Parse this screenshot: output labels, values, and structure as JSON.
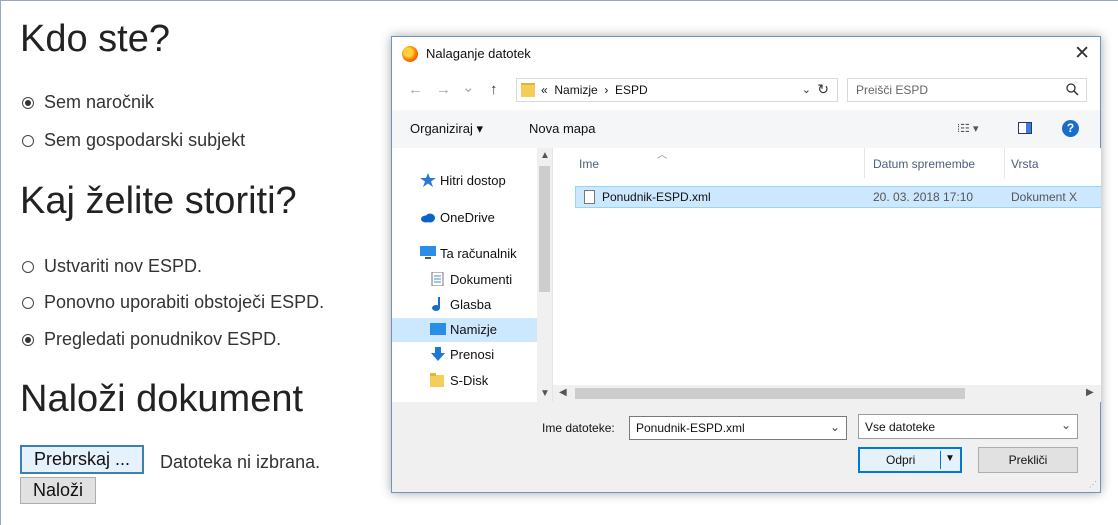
{
  "form": {
    "who_title": "Kdo ste?",
    "role_options": [
      {
        "label": "Sem naročnik",
        "checked": true
      },
      {
        "label": "Sem gospodarski subjekt",
        "checked": false
      }
    ],
    "action_title": "Kaj želite storiti?",
    "action_options": [
      {
        "label": "Ustvariti nov ESPD.",
        "checked": false
      },
      {
        "label": "Ponovno uporabiti obstoječi ESPD.",
        "checked": false
      },
      {
        "label": "Pregledati ponudnikov ESPD.",
        "checked": true
      }
    ],
    "upload_title": "Naloži dokument",
    "browse_label": "Prebrskaj ...",
    "file_status": "Datoteka ni izbrana.",
    "upload_button": "Naloži"
  },
  "dialog": {
    "title": "Nalaganje datotek",
    "close_glyph": "✕",
    "nav": {
      "back": "←",
      "forward": "→",
      "recent": "⌄",
      "up": "↑"
    },
    "address": {
      "prefix": "«",
      "path": [
        "Namizje",
        "ESPD"
      ],
      "separator": "›",
      "dropdown": "⌄",
      "refresh": "↻"
    },
    "search_placeholder": "Preišči ESPD",
    "toolbar": {
      "organize": "Organiziraj ▾",
      "new_folder": "Nova mapa",
      "view": "⁞☷ ▾",
      "help": "?"
    },
    "nav_items": [
      {
        "label": "Hitri dostop",
        "icon": "star-icon",
        "selected": false
      },
      {
        "label": "OneDrive",
        "icon": "cloud-icon",
        "selected": false
      },
      {
        "label": "Ta računalnik",
        "icon": "computer-icon",
        "selected": false
      },
      {
        "label": "Dokumenti",
        "icon": "document-icon",
        "selected": false
      },
      {
        "label": "Glasba",
        "icon": "music-icon",
        "selected": false
      },
      {
        "label": "Namizje",
        "icon": "desktop-icon",
        "selected": true
      },
      {
        "label": "Prenosi",
        "icon": "download-icon",
        "selected": false
      },
      {
        "label": "S-Disk",
        "icon": "folder-icon",
        "selected": false
      }
    ],
    "columns": {
      "name": "Ime",
      "date": "Datum spremembe",
      "type": "Vrsta"
    },
    "files": [
      {
        "name": "Ponudnik-ESPD.xml",
        "date": "20. 03. 2018 17:10",
        "type": "Dokument X"
      }
    ],
    "filename_label": "Ime datoteke:",
    "filename_value": "Ponudnik-ESPD.xml",
    "filetype_value": "Vse datoteke",
    "open_button": "Odpri",
    "cancel_button": "Prekliči",
    "colors": {
      "selection": "#cce8ff",
      "accent": "#0078d7"
    }
  }
}
